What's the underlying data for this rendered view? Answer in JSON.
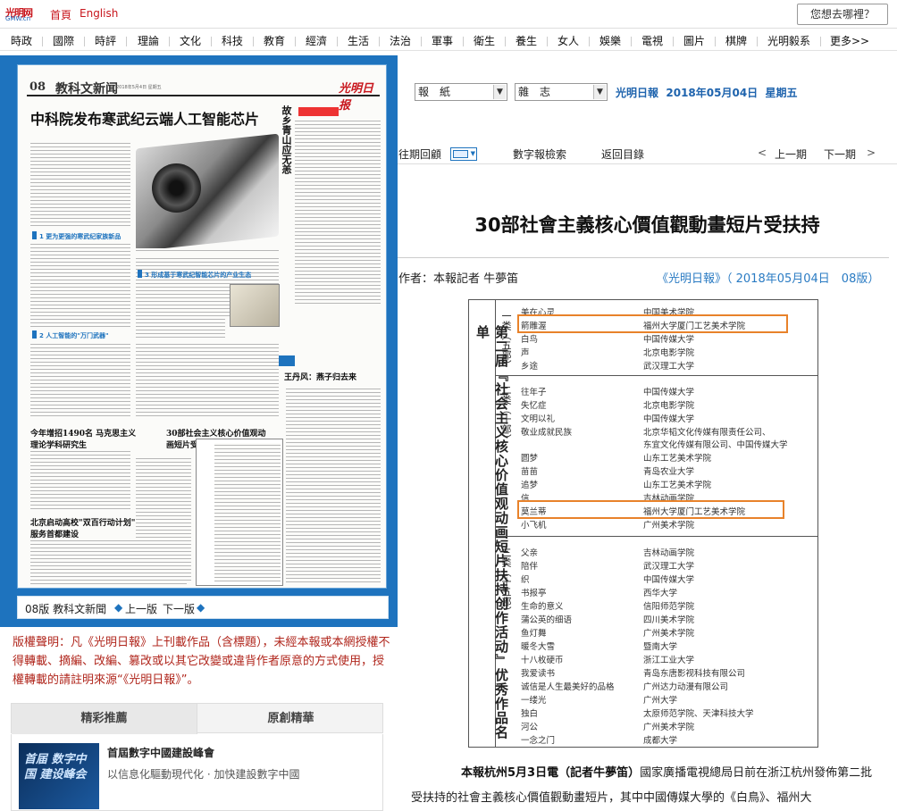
{
  "header": {
    "logo_line1": "光明网",
    "logo_line2": "GMW.cn",
    "home_link": "首頁",
    "english_link": "English",
    "search_button": "您想去哪裡？"
  },
  "nav": [
    "時政",
    "國際",
    "時評",
    "理論",
    "文化",
    "科技",
    "教育",
    "經濟",
    "生活",
    "法治",
    "軍事",
    "衛生",
    "養生",
    "女人",
    "娛樂",
    "電視",
    "圖片",
    "棋牌",
    "光明毅系",
    "更多>>"
  ],
  "paper": {
    "page_no": "08",
    "section": "教科文新闻",
    "date_small": "2018年5月4日 星期五",
    "masthead": "光明日报",
    "headline": "中科院发布寒武纪云端人工智能芯片",
    "vertical_title": "故乡青山应无恙",
    "sub1": "1 更为更强的寒武纪家族新品",
    "sub2": "2 人工智能的\"万门武器\"",
    "sub3": "3 形成基于寒武纪智能芯片的产业生态",
    "story1": "今年增招1490名 马克思主义理论学科研究生",
    "story2": "30部社会主义核心价值观动画短片受扶持",
    "story3": "北京启动高校\"双百行动计划\" 服务首都建设",
    "story4": "王丹风：燕子归去来"
  },
  "page_footer": {
    "edition": "08版 教科文新聞",
    "prev": "上一版",
    "next": "下一版"
  },
  "copyright": "版權聲明：凡《光明日報》上刊載作品（含標題），未經本報或本網授權不得轉載、摘編、改編、篡改或以其它改變或違背作者原意的方式使用，授權轉載的請註明來源“《光明日報》”。",
  "tabs": {
    "t1": "精彩推薦",
    "t2": "原創精華"
  },
  "card": {
    "thumb_text": "首届 数字中国 建设峰会",
    "title": "首屆數字中國建設峰會",
    "desc": "以信息化驅動現代化 · 加快建設數字中國"
  },
  "selectors": {
    "s1": "報　紙",
    "s2": "雜　志",
    "paper_name": "光明日報",
    "date": "2018年05月04日",
    "weekday": "星期五"
  },
  "toolbar": {
    "review": "往期回顧",
    "search": "數字報檢索",
    "back": "返回目錄",
    "prev": "上一期",
    "next": "下一期"
  },
  "article": {
    "title": "30部社會主義核心價值觀動畫短片受扶持",
    "author": "作者：本報記者 牛夢笛",
    "source": "《光明日報》（ 2018年05月04日　08版）",
    "lead_bold": "本報杭州5月3日電（記者牛夢笛）",
    "lead_text": "國家廣播電視總局日前在浙江杭州發佈第二批受扶持的社會主義核心價值觀動畫短片，其中中國傳媒大學的《白鳥》、福州大"
  },
  "list": {
    "vertical_title": "第二届『社会主义核心价值观动画短片扶持创作活动』优秀作品名单",
    "cat1": "一类（五部）",
    "cat2": "二类（十部）",
    "cat3": "三类（十五部）",
    "rows1": [
      [
        "美在心灵",
        "中国美术学院"
      ],
      [
        "箭雕渥",
        "福州大学厦门工艺美术学院"
      ],
      [
        "白鸟",
        "中国传媒大学"
      ],
      [
        "声",
        "北京电影学院"
      ],
      [
        "乡途",
        "武汉理工大学"
      ]
    ],
    "rows2": [
      [
        "往年子",
        "中国传媒大学"
      ],
      [
        "失忆症",
        "北京电影学院"
      ],
      [
        "文明以礼",
        "中国传媒大学"
      ],
      [
        "敬业成就民族",
        "北京华韬文化传媒有限责任公司、"
      ],
      [
        "",
        "东宜文化传媒有限公司、中国传媒大学"
      ],
      [
        "圆梦",
        "山东工艺美术学院"
      ],
      [
        "苗苗",
        "青岛农业大学"
      ],
      [
        "追梦",
        "山东工艺美术学院"
      ],
      [
        "信",
        "吉林动画学院"
      ],
      [
        "莫兰蒂",
        "福州大学厦门工艺美术学院"
      ],
      [
        "小飞机",
        "广州美术学院"
      ]
    ],
    "rows3": [
      [
        "父亲",
        "吉林动画学院"
      ],
      [
        "陪伴",
        "武汉理工大学"
      ],
      [
        "织",
        "中国传媒大学"
      ],
      [
        "书报亭",
        "西华大学"
      ],
      [
        "生命的意义",
        "信阳师范学院"
      ],
      [
        "蒲公英的细语",
        "四川美术学院"
      ],
      [
        "鱼灯舞",
        "广州美术学院"
      ],
      [
        "暖冬大雪",
        "暨南大学"
      ],
      [
        "十八枚硬币",
        "浙江工业大学"
      ],
      [
        "我爱读书",
        "青岛东唐影视科技有限公司"
      ],
      [
        "诚信是人生最美好的品格",
        "广州达力动漫有限公司"
      ],
      [
        "一缕光",
        "广州大学"
      ],
      [
        "独白",
        "太原师范学院、天津科技大学"
      ],
      [
        "河公",
        "广州美术学院"
      ],
      [
        "一念之门",
        "成都大学"
      ]
    ]
  }
}
